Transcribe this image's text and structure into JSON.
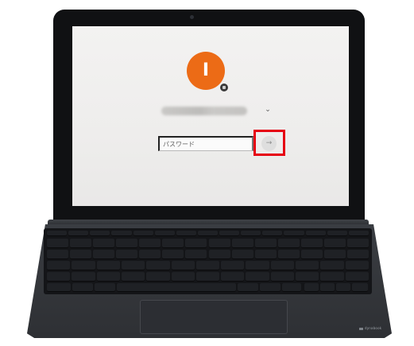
{
  "login": {
    "avatar_letter": "I",
    "password_placeholder": "パスワード",
    "submit_label": "→",
    "user_menu_chevron": "⌄"
  },
  "icons": {
    "avatar_badge": "device-badge-icon",
    "submit": "arrow-right-icon",
    "user_menu": "chevron-down-icon"
  },
  "brand": {
    "logo_text": "dynabook"
  },
  "colors": {
    "avatar": "#ec6b16",
    "highlight": "#e60012",
    "screen_bg": "#f3f2f1",
    "bezel": "#101113",
    "keyboard": "#141518"
  }
}
